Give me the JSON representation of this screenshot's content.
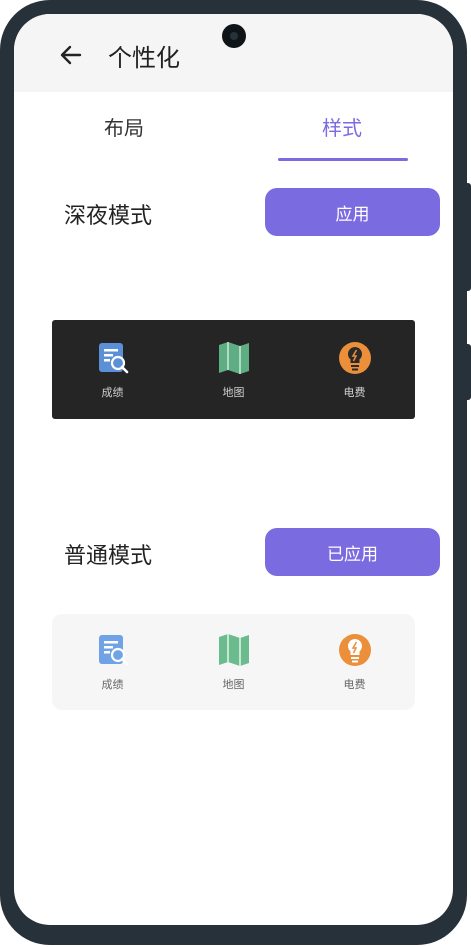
{
  "header": {
    "title": "个性化"
  },
  "tabs": [
    {
      "label": "布局",
      "active": false
    },
    {
      "label": "样式",
      "active": true
    }
  ],
  "dark_mode": {
    "label": "深夜模式",
    "button_label": "应用",
    "preview_items": [
      {
        "label": "成绩",
        "icon": "score-search-icon"
      },
      {
        "label": "地图",
        "icon": "map-icon"
      },
      {
        "label": "电费",
        "icon": "electricity-bulb-icon"
      }
    ]
  },
  "normal_mode": {
    "label": "普通模式",
    "button_label": "已应用",
    "preview_items": [
      {
        "label": "成绩",
        "icon": "score-search-icon"
      },
      {
        "label": "地图",
        "icon": "map-icon"
      },
      {
        "label": "电费",
        "icon": "electricity-bulb-icon"
      }
    ]
  },
  "colors": {
    "accent": "#7a6be0",
    "dark_preview_bg": "#252525",
    "light_preview_bg": "#f6f6f6",
    "icon_blue": "#5b8fd6",
    "icon_green": "#5fae83",
    "icon_orange": "#ec8f3a"
  }
}
